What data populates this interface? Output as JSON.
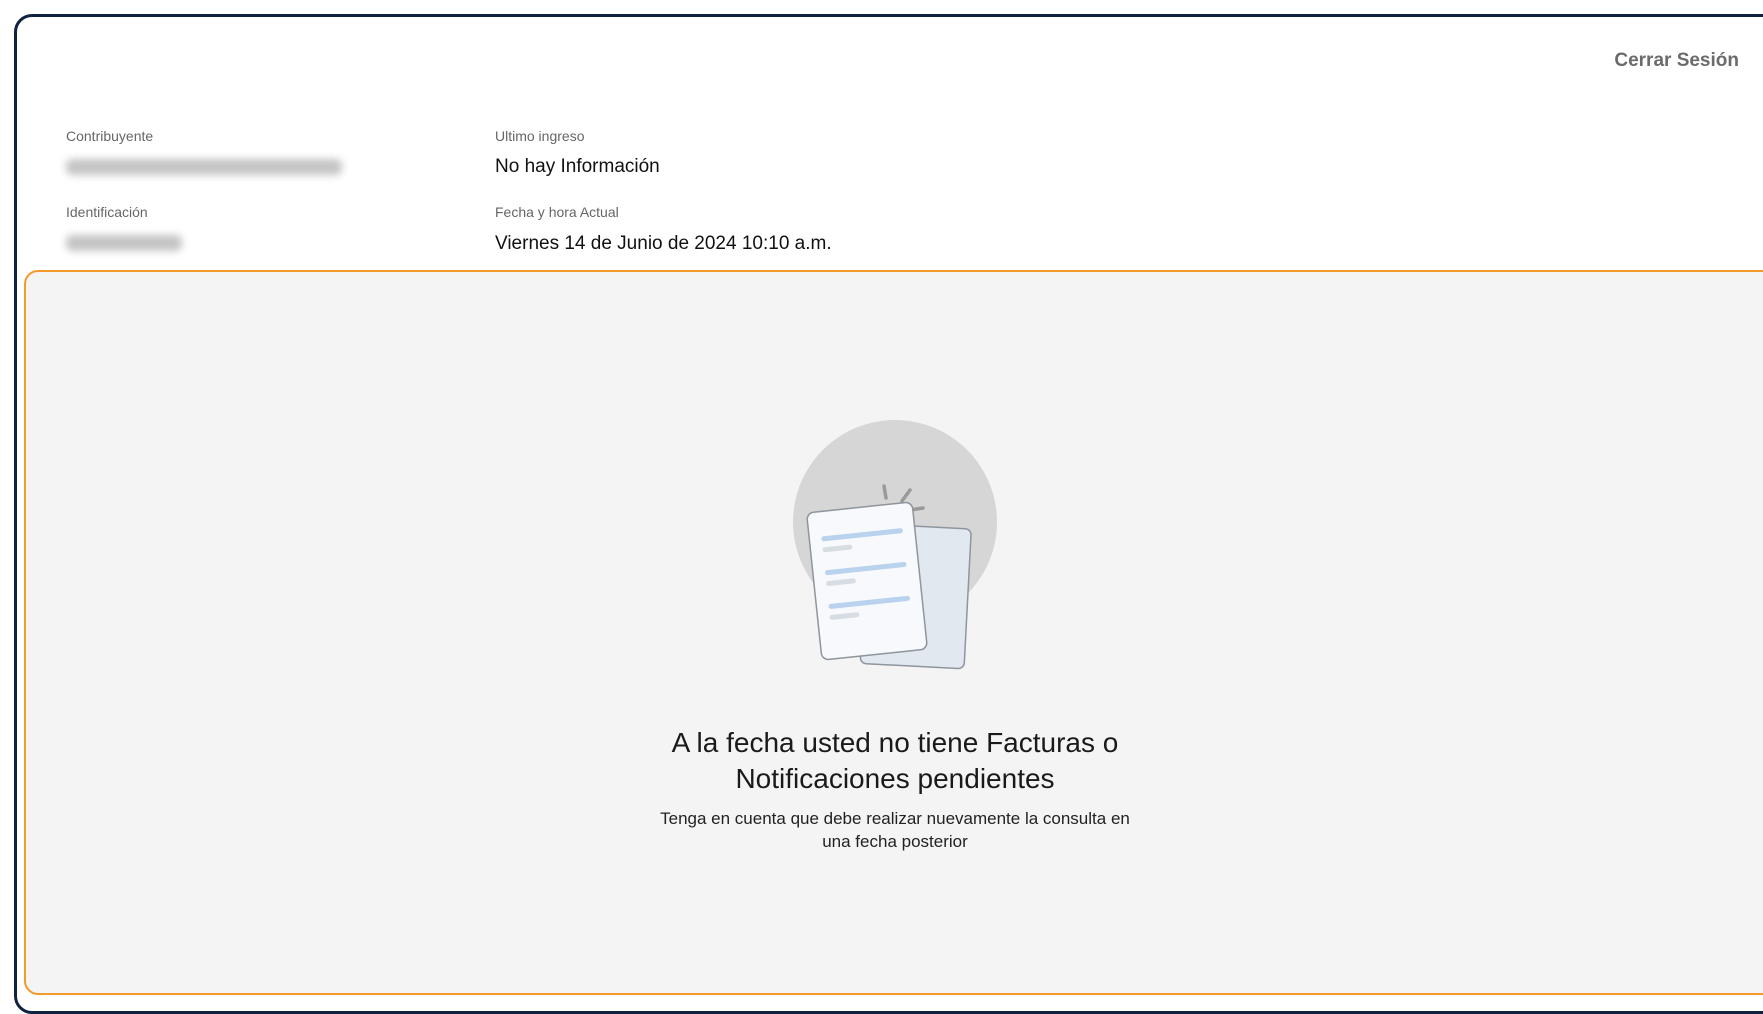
{
  "header": {
    "logout_label": "Cerrar Sesión"
  },
  "info": {
    "contribuyente_label": "Contribuyente",
    "ultimo_ingreso_label": "Ultimo ingreso",
    "ultimo_ingreso_value": "No hay Información",
    "identificacion_label": "Identificación",
    "fecha_actual_label": "Fecha y hora Actual",
    "fecha_actual_value": "Viernes 14 de Junio de 2024 10:10 a.m."
  },
  "empty_state": {
    "icon": "empty-documents-icon",
    "title": "A la fecha usted no tiene Facturas o Notificaciones pendientes",
    "subtitle": "Tenga en cuenta que debe realizar nuevamente la consulta en una fecha posterior"
  },
  "colors": {
    "frame_border": "#0f2340",
    "panel_border": "#f39a2d",
    "panel_background": "#f4f4f4"
  }
}
